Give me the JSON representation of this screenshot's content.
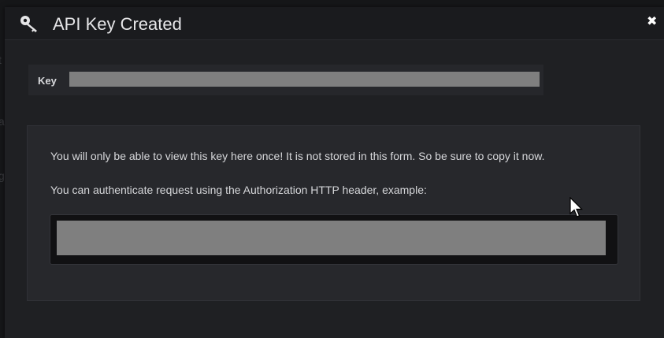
{
  "dialog": {
    "title": "API Key Created",
    "header_icon": "key-icon",
    "close_icon": "close-icon",
    "close_glyph": "✖"
  },
  "key_field": {
    "label": "Key",
    "value": ""
  },
  "info": {
    "line1": "You will only be able to view this key here once! It is not stored in this form. So be sure to copy it now.",
    "line2": "You can authenticate request using the Authorization HTTP header, example:",
    "example_value": ""
  },
  "colors": {
    "modal_background": "#1f2023",
    "panel_background": "#27282c",
    "redacted": "#7f7f7f",
    "code_background": "#111113"
  }
}
